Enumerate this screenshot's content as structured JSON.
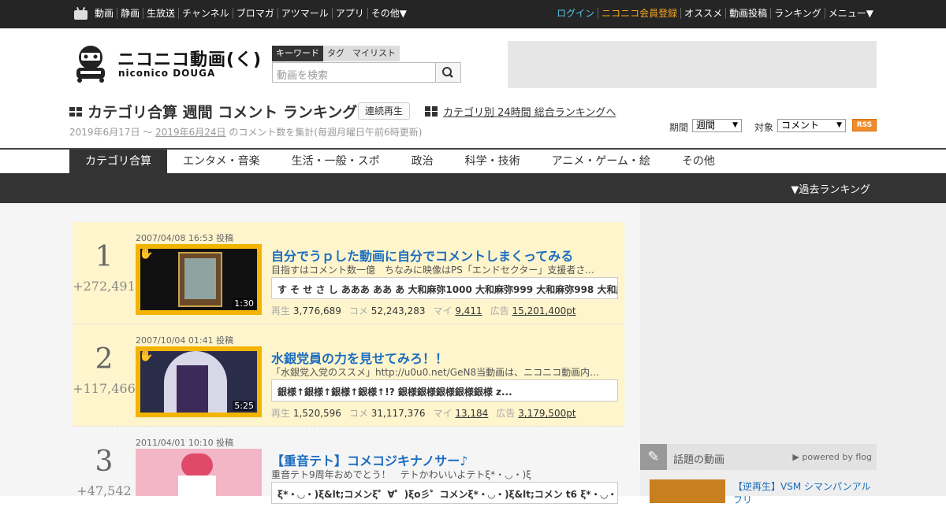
{
  "topbar": {
    "left_items": [
      "動画",
      "静画",
      "生放送",
      "チャンネル",
      "ブロマガ",
      "アツマール",
      "アプリ",
      "その他▼"
    ],
    "right_items": [
      "ログイン",
      "ニコニコ会員登録",
      "オススメ",
      "動画投稿",
      "ランキング",
      "メニュー▼"
    ]
  },
  "logo": {
    "name_ja": "ニコニコ動画(く)",
    "name_en": "niconico DOUGA"
  },
  "search": {
    "tabs": [
      "キーワード",
      "タグ",
      "マイリスト"
    ],
    "placeholder": "動画を検索"
  },
  "header": {
    "title": "カテゴリ合算 週間 コメント ランキング",
    "continuous_play": "連続再生",
    "alt_link": "カテゴリ別 24時間 総合ランキングへ",
    "period_start": "2019年6月17日 ～",
    "period_end": "2019年6月24日",
    "period_suffix": "のコメント数を集計(毎週月曜日午前6時更新)",
    "term_label": "期間",
    "term_value": "週間",
    "target_label": "対象",
    "target_value": "コメント",
    "rss": "RSS"
  },
  "tabs": [
    "カテゴリ合算",
    "エンタメ・音楽",
    "生活・一般・スポ",
    "政治",
    "科学・技術",
    "アニメ・ゲーム・絵",
    "その他"
  ],
  "past_ranking": "▼過去ランキング",
  "stat_labels": {
    "views": "再生",
    "comments": "コメ",
    "mylist": "マイ",
    "ads": "広告"
  },
  "entries": [
    {
      "rank": "1",
      "delta": "+272,491",
      "posted": "2007/04/08 16:53 投稿",
      "duration": "1:30",
      "title": "自分でうｐした動画に自分でコメントしまくってみる",
      "desc": "目指すはコメント数一億　ちなみに映像はPS「エンドセクター」支援者さ...",
      "comment": "す そ せ さ し あああ ああ あ 大和麻弥1000 大和麻弥999 大和麻弥998 大和麻",
      "views": "3,776,689",
      "comments": "52,243,283",
      "mylist": "9,411",
      "ads": "15,201,400pt"
    },
    {
      "rank": "2",
      "delta": "+117,466",
      "posted": "2007/10/04 01:41 投稿",
      "duration": "5:25",
      "title": "水銀党員の力を見せてみろ！！",
      "desc": "「水銀党入党のススメ」http://u0u0.net/GeN8当動画は、ニコニコ動画内...",
      "comment": "銀様↑銀様↑銀様↑銀様↑!? 銀様銀様銀様銀様銀様 z...",
      "views": "1,520,596",
      "comments": "31,117,376",
      "mylist": "13,184",
      "ads": "3,179,500pt"
    },
    {
      "rank": "3",
      "delta": "+47,542",
      "posted": "2011/04/01 10:10 投稿",
      "duration": "",
      "title": "【重音テト】コメコジキナノサー♪",
      "desc": "重音テト9周年おめでとう！　テトかわいいよテトξ*・◡・)ξ",
      "comment": "ξ*・◡・)ξ&lt;コメンξ゜∀゜)ξo彡゜コメンξ*・◡・)ξ&lt;コメン t6 ξ*・◡・)ξ&l",
      "views": "",
      "comments": "",
      "mylist": "",
      "ads": ""
    }
  ],
  "sidebar": {
    "trending_title": "話題の動画",
    "powered_by": "▶ powered by flog",
    "trend_item_title": "【逆再生】VSM シマンパンアルフリ"
  }
}
